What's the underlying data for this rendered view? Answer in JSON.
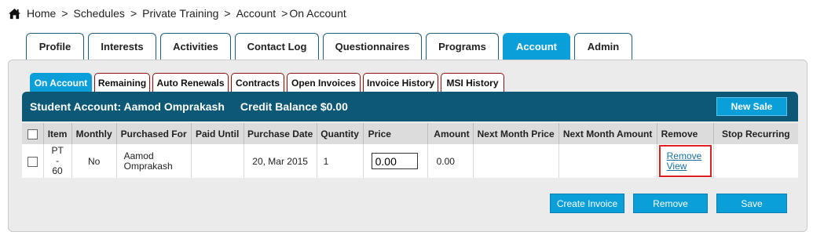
{
  "breadcrumb": {
    "home": "Home",
    "items": [
      "Schedules",
      "Private Training",
      "Account",
      "On Account"
    ],
    "separator": ">"
  },
  "top_tabs": [
    {
      "label": "Profile",
      "active": false
    },
    {
      "label": "Interests",
      "active": false
    },
    {
      "label": "Activities",
      "active": false
    },
    {
      "label": "Contact Log",
      "active": false
    },
    {
      "label": "Questionnaires",
      "active": false
    },
    {
      "label": "Programs",
      "active": false
    },
    {
      "label": "Account",
      "active": true
    },
    {
      "label": "Admin",
      "active": false
    }
  ],
  "sub_tabs": [
    {
      "label": "On Account",
      "active": true
    },
    {
      "label": "Remaining",
      "active": false
    },
    {
      "label": "Auto Renewals",
      "active": false
    },
    {
      "label": "Contracts",
      "active": false
    },
    {
      "label": "Open Invoices",
      "active": false
    },
    {
      "label": "Invoice History",
      "active": false
    },
    {
      "label": "MSI History",
      "active": false
    }
  ],
  "account": {
    "student_label": "Student Account: Aamod Omprakash",
    "credit_label": "Credit Balance $0.00",
    "new_sale_button": "New Sale"
  },
  "table": {
    "headers": [
      "Item",
      "Monthly",
      "Purchased For",
      "Paid Until",
      "Purchase Date",
      "Quantity",
      "Price",
      "Amount",
      "Next Month Price",
      "Next Month Amount",
      "Remove",
      "Stop Recurring"
    ],
    "rows": [
      {
        "item": "PT - 60",
        "monthly": "No",
        "purchased_for": "Aamod Omprakash",
        "paid_until": "",
        "purchase_date": "20, Mar 2015",
        "quantity": "1",
        "price": "0.00",
        "amount": "0.00",
        "next_month_price": "",
        "next_month_amount": "",
        "remove_link": "Remove",
        "view_link": "View",
        "stop_recurring": ""
      }
    ]
  },
  "buttons": {
    "create_invoice": "Create Invoice",
    "remove": "Remove",
    "save": "Save"
  },
  "colors": {
    "accent": "#0b9fd9",
    "header_bar": "#0c5876",
    "highlight": "#e02020"
  }
}
